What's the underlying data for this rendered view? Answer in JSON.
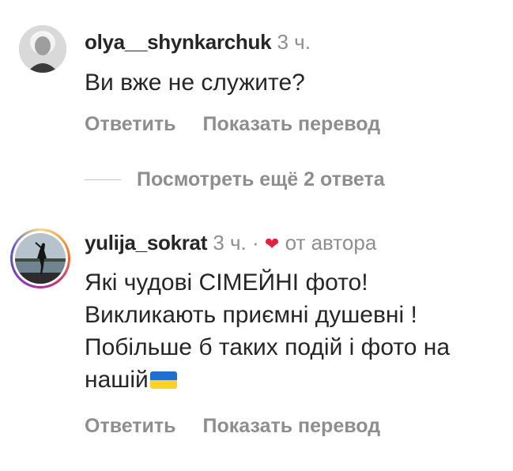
{
  "comment1": {
    "username": "olya__shynkarchuk",
    "time": "3 ч.",
    "text": "Ви вже не служите?",
    "reply_label": "Ответить",
    "translate_label": "Показать перевод"
  },
  "view_replies": {
    "label": "Посмотреть ещё 2 ответа"
  },
  "comment2": {
    "username": "yulija_sokrat",
    "time": "3 ч.",
    "separator": "·",
    "heart": "❤",
    "by_author": "от автора",
    "text": "Які чудові СІМЕЙНІ фото! Викликають приємні душевні ! Побільше б таких подій і фото на нашій",
    "flag_icon": "ukraine-flag-icon",
    "reply_label": "Ответить",
    "translate_label": "Показать перевод"
  },
  "colors": {
    "secondary_text": "#8e8e8e",
    "primary_text": "#262626",
    "heart": "#ed1c3e",
    "story_ring": "gradient"
  }
}
